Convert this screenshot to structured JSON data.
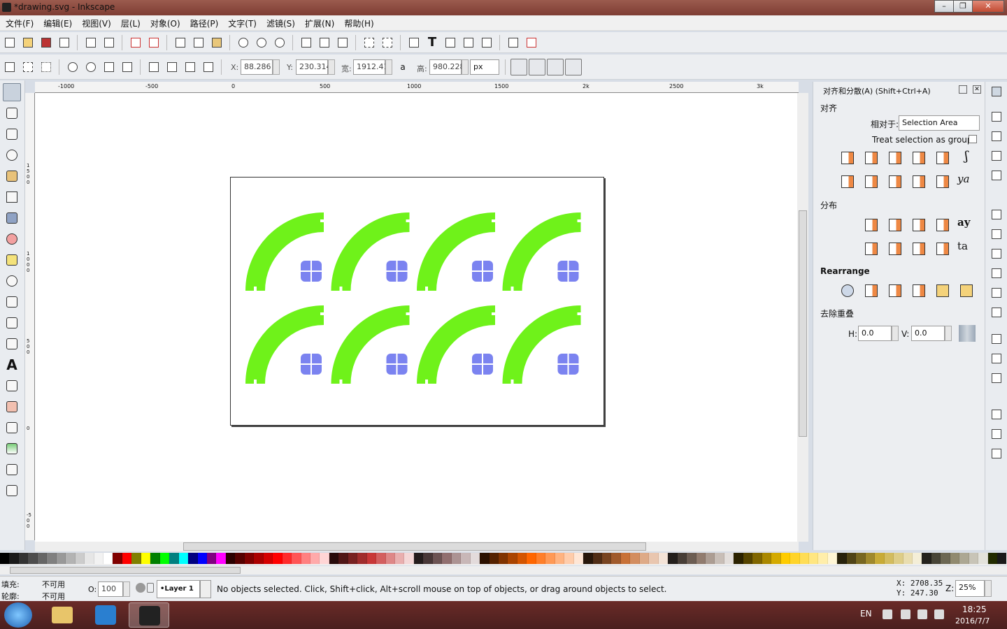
{
  "window": {
    "title": "*drawing.svg - Inkscape",
    "controls": [
      "–",
      "❐",
      "✕"
    ]
  },
  "menu": [
    "文件(F)",
    "编辑(E)",
    "视图(V)",
    "层(L)",
    "对象(O)",
    "路径(P)",
    "文字(T)",
    "滤镜(S)",
    "扩展(N)",
    "帮助(H)"
  ],
  "select_toolbar": {
    "x_label": "X:",
    "x_value": "88.286",
    "y_label": "Y:",
    "y_value": "230.314",
    "w_label": "宽:",
    "w_value": "1912.41",
    "h_label": "高:",
    "h_value": "980.228",
    "unit": "px"
  },
  "rulers": {
    "horizontal_ticks": [
      "-1000",
      "-500",
      "0",
      "500",
      "1000",
      "1500",
      "2k",
      "2500",
      "3k"
    ],
    "vertical_ticks": [
      "1500",
      "1000",
      "500",
      "0",
      "-500"
    ]
  },
  "align_panel": {
    "title": "对齐和分散(A) (Shift+Ctrl+A)",
    "align_header": "对齐",
    "relative_to_label": "相对于:",
    "relative_to_value": "Selection Area",
    "treat_as_group_label": "Treat selection as group:",
    "treat_as_group_checked": false,
    "distribute_header": "分布",
    "rearrange_header": "Rearrange",
    "remove_overlap_header": "去除重叠",
    "h_label": "H:",
    "h_value": "0.0",
    "v_label": "V:",
    "v_value": "0.0"
  },
  "drawing": {
    "arc_color": "#6ff21a",
    "cross_color": "#7b83f0",
    "rows": 2,
    "columns": 4
  },
  "status": {
    "fill_label": "填充:",
    "fill_value": "不可用",
    "stroke_label": "轮廓:",
    "stroke_value": "不可用",
    "opacity_label": "O:",
    "opacity_value": "100",
    "layer": "•Layer 1",
    "message": "No objects selected. Click, Shift+click, Alt+scroll mouse on top of objects, or drag around objects to select.",
    "cursor_x": "X: 2708.35",
    "cursor_y": "Y:  247.30",
    "zoom_label": "Z:",
    "zoom_value": "25%"
  },
  "palette": [
    "#000000",
    "#1a1a1a",
    "#333333",
    "#4d4d4d",
    "#666666",
    "#808080",
    "#999999",
    "#b3b3b3",
    "#cccccc",
    "#e6e6e6",
    "#f2f2f2",
    "#ffffff",
    "#800000",
    "#ff0000",
    "#808000",
    "#ffff00",
    "#008000",
    "#00ff00",
    "#008080",
    "#00ffff",
    "#000080",
    "#0000ff",
    "#800080",
    "#ff00ff",
    "#2b0000",
    "#550000",
    "#800000",
    "#aa0000",
    "#d40000",
    "#ff0000",
    "#ff2a2a",
    "#ff5555",
    "#ff8080",
    "#ffaaaa",
    "#ffd5d5",
    "#280b0b",
    "#501616",
    "#782121",
    "#a02c2c",
    "#c83737",
    "#d35f5f",
    "#de8787",
    "#e9afaf",
    "#f4d7d7",
    "#241c1c",
    "#483737",
    "#6c5353",
    "#916f6f",
    "#ac9393",
    "#c8b7b7",
    "#e3dbdb",
    "#2b1100",
    "#552200",
    "#803300",
    "#aa4400",
    "#d45500",
    "#ff6600",
    "#ff7f2a",
    "#ff9955",
    "#ffb380",
    "#ffccaa",
    "#ffe6d5",
    "#28170b",
    "#502d16",
    "#784421",
    "#a05a2c",
    "#c87137",
    "#d38d5f",
    "#deaa87",
    "#e9c6af",
    "#f4e3d7",
    "#241f1c",
    "#483e37",
    "#6c5d53",
    "#917c6f",
    "#ac9d93",
    "#c8beb7",
    "#e3dedb",
    "#2b2200",
    "#554400",
    "#806600",
    "#aa8800",
    "#d4aa00",
    "#ffcc00",
    "#ffd42a",
    "#ffdd55",
    "#ffe680",
    "#ffeeaa",
    "#fff6d5",
    "#28220b",
    "#504416",
    "#786721",
    "#a0892c",
    "#c8ab37",
    "#d3bc5f",
    "#decd87",
    "#e9ddaf",
    "#f4eed7",
    "#24221c",
    "#484537",
    "#6c6753",
    "#918a6f",
    "#aca793",
    "#c8c4b7",
    "#e3e2db",
    "#222b00",
    "#1a1a1a"
  ],
  "taskbar": {
    "lang": "EN",
    "time": "18:25",
    "date": "2016/7/7"
  }
}
